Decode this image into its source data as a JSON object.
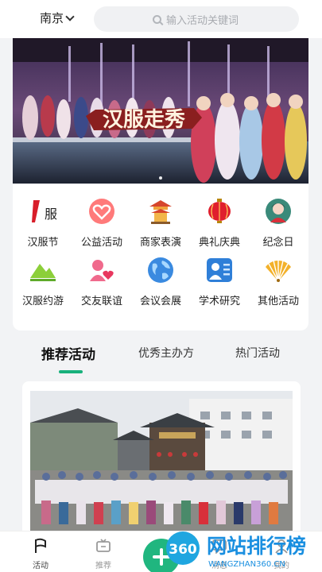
{
  "header": {
    "city": "南京",
    "search_placeholder": "输入活动关键词"
  },
  "banner": {
    "title": "汉服走秀"
  },
  "categories": [
    {
      "label": "汉服节",
      "icon": "hanfu-festival-icon"
    },
    {
      "label": "公益活动",
      "icon": "charity-heart-icon"
    },
    {
      "label": "商家表演",
      "icon": "pavilion-icon"
    },
    {
      "label": "典礼庆典",
      "icon": "lantern-icon"
    },
    {
      "label": "纪念日",
      "icon": "lady-portrait-icon"
    },
    {
      "label": "汉服约游",
      "icon": "mountain-icon"
    },
    {
      "label": "交友联谊",
      "icon": "friends-heart-icon"
    },
    {
      "label": "会议会展",
      "icon": "globe-icon"
    },
    {
      "label": "学术研究",
      "icon": "scholar-icon"
    },
    {
      "label": "其他活动",
      "icon": "fan-icon"
    }
  ],
  "tabs": [
    "推荐活动",
    "优秀主办方",
    "热门活动"
  ],
  "bottom_nav": [
    {
      "label": "活动",
      "icon": "flag-icon"
    },
    {
      "label": "推荐",
      "icon": "tv-icon"
    },
    {
      "label": "",
      "icon": "plus-icon"
    },
    {
      "label": "消息",
      "icon": "message-icon"
    },
    {
      "label": "我的",
      "icon": "user-icon"
    }
  ],
  "watermark": {
    "text": "网站排行榜",
    "brand": "360",
    "sub": "WANGZHAN360.CN"
  },
  "colors": {
    "accent": "#19b17c",
    "banner_red": "#8a1f1f"
  }
}
